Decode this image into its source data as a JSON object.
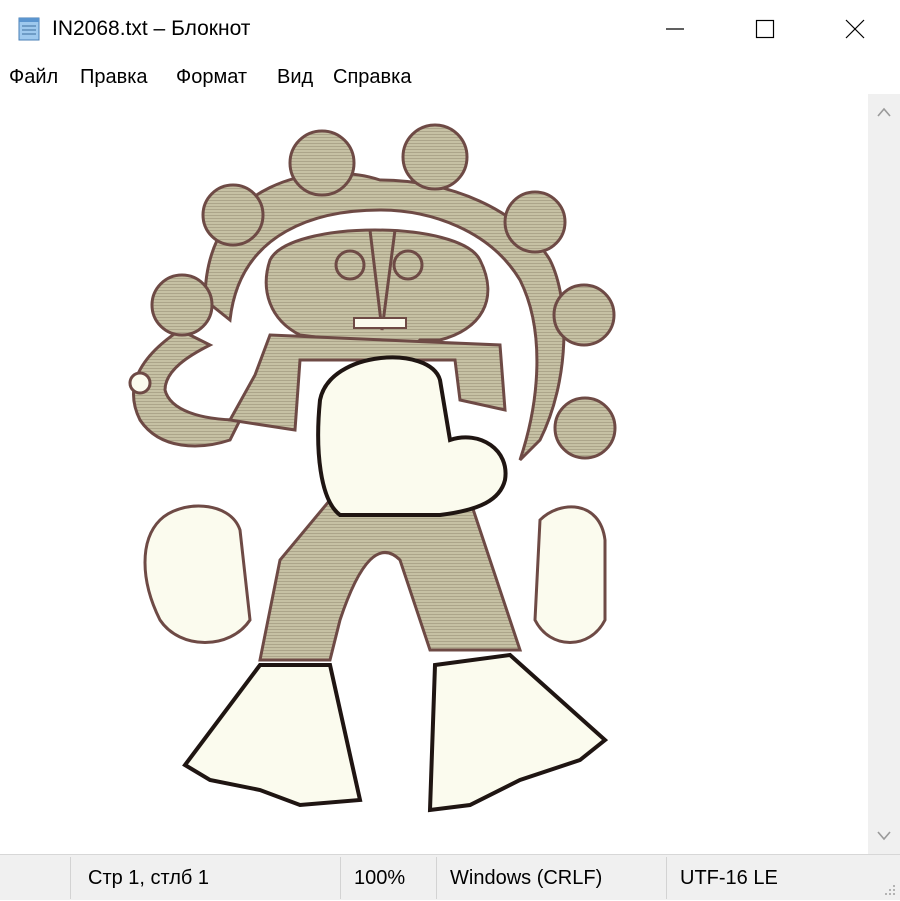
{
  "window": {
    "title": "IN2068.txt – Блокнот",
    "icon": "notepad-icon",
    "controls": [
      "minimize-icon",
      "maximize-icon",
      "close-icon"
    ]
  },
  "menu": {
    "items": [
      {
        "label": "Файл"
      },
      {
        "label": "Правка"
      },
      {
        "label": "Формат"
      },
      {
        "label": "Вид"
      },
      {
        "label": "Справка"
      }
    ]
  },
  "status": {
    "position": "Стр 1, стлб 1",
    "zoom": "100%",
    "line_ending": "Windows (CRLF)",
    "encoding": "UTF-16 LE"
  },
  "colors": {
    "figure_fill": "#c6c1a4",
    "figure_light": "#fbfbee",
    "figure_outline": "#6e4a45",
    "figure_dark": "#1f1512",
    "statusbar_bg": "#f0f0f0"
  }
}
